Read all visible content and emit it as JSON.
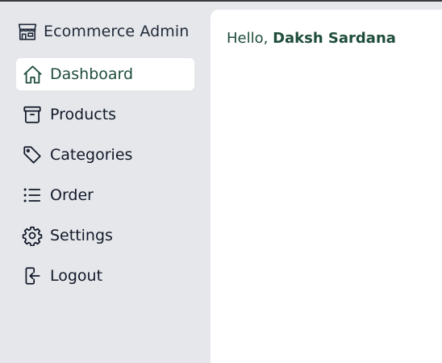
{
  "brand": {
    "icon": "store-icon",
    "label": "Ecommerce Admin"
  },
  "nav": {
    "active_color": "#1e4d3a",
    "items": [
      {
        "label": "Dashboard",
        "icon": "home-icon",
        "active": true
      },
      {
        "label": "Products",
        "icon": "archive-box-icon",
        "active": false
      },
      {
        "label": "Categories",
        "icon": "tag-icon",
        "active": false
      },
      {
        "label": "Order",
        "icon": "list-icon",
        "active": false
      },
      {
        "label": "Settings",
        "icon": "gear-icon",
        "active": false
      },
      {
        "label": "Logout",
        "icon": "logout-icon",
        "active": false
      }
    ]
  },
  "main": {
    "greeting_prefix": "Hello, ",
    "user_name": "Daksh Sardana"
  }
}
